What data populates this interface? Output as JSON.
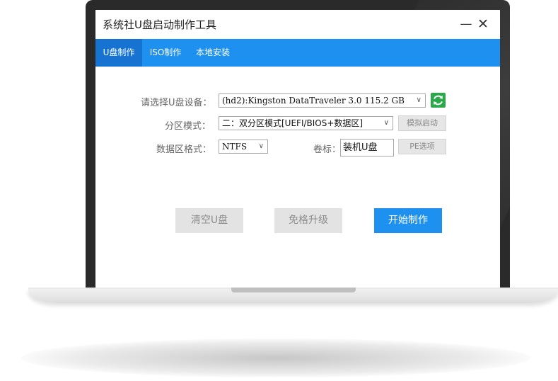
{
  "window": {
    "title": "系统社U盘启动制作工具",
    "minimize_glyph": "—",
    "close_glyph": "✕"
  },
  "tabs": [
    {
      "label": "U盘制作",
      "active": true
    },
    {
      "label": "ISO制作",
      "active": false
    },
    {
      "label": "本地安装",
      "active": false
    }
  ],
  "form": {
    "device_label": "请选择U盘设备：",
    "device_value": "(hd2):Kingston DataTraveler 3.0 115.2 GB",
    "partition_label": "分区模式：",
    "partition_value": "二：双分区模式[UEFI/BIOS+数据区]",
    "simulate_button": "模拟启动",
    "format_label": "数据区格式：",
    "format_value": "NTFS",
    "volume_label": "卷标：",
    "volume_value": "装机U盘",
    "pe_options_button": "PE选项"
  },
  "actions": {
    "clear": "清空U盘",
    "upgrade": "免格升级",
    "start": "开始制作"
  },
  "icons": {
    "refresh": "refresh-icon",
    "dropdown": "chevron-down-icon"
  },
  "colors": {
    "accent": "#1e90f0",
    "active_tab": "#1673d2",
    "refresh": "#2aa84a"
  }
}
